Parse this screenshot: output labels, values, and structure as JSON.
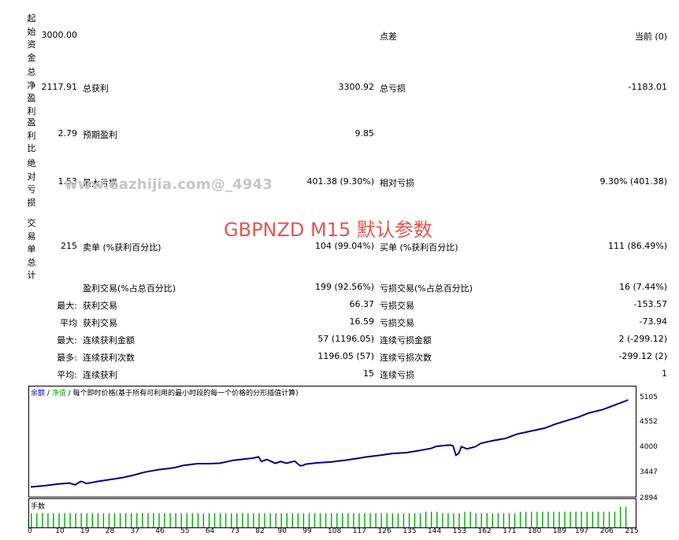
{
  "stats": {
    "rows": [
      {
        "label": "起始资金",
        "value": "3000.00",
        "mid_label": "",
        "mid_value": "",
        "right_label": "点差",
        "right_value": "当前 (0)"
      },
      {
        "label": "总净盈利",
        "value": "2117.91",
        "mid_label": "总获利",
        "mid_value": "3300.92",
        "right_label": "总亏损",
        "right_value": "-1183.01"
      },
      {
        "label": "盈利比",
        "value": "2.79",
        "mid_label": "预期盈利",
        "mid_value": "9.85",
        "right_label": "",
        "right_value": ""
      },
      {
        "label": "绝对亏损",
        "value": "1.53",
        "mid_label": "最大亏损",
        "mid_value": "401.38 (9.30%)",
        "right_label": "相对亏损",
        "right_value": "9.30% (401.38)"
      },
      {
        "label": "交易单总计",
        "value": "215",
        "mid_label": "卖单 (%获利百分比)",
        "mid_value": "104 (99.04%)",
        "right_label": "买单 (%获利百分比)",
        "right_value": "111 (86.49%)"
      }
    ],
    "subrows": [
      {
        "prefix": "",
        "mid_label": "盈利交易(%占总百分比)",
        "mid_value": "199 (92.56%)",
        "right_label": "亏损交易(%占总百分比)",
        "right_value": "16 (7.44%)"
      },
      {
        "prefix": "最大:",
        "mid_label": "获利交易",
        "mid_value": "66.37",
        "right_label": "亏损交易",
        "right_value": "-153.57"
      },
      {
        "prefix": "平均",
        "mid_label": "获利交易",
        "mid_value": "16.59",
        "right_label": "亏损交易",
        "right_value": "-73.94"
      },
      {
        "prefix": "最大:",
        "mid_label": "连续获利金额",
        "mid_value": "57 (1196.05)",
        "right_label": "连续亏损金额",
        "right_value": "2 (-299.12)"
      },
      {
        "prefix": "最多:",
        "mid_label": "连续获利次数",
        "mid_value": "1196.05 (57)",
        "right_label": "连续亏损次数",
        "right_value": "-299.12 (2)"
      },
      {
        "prefix": "平均:",
        "mid_label": "连续获利",
        "mid_value": "15",
        "right_label": "连续亏损",
        "right_value": "1"
      }
    ]
  },
  "watermark": "www.eazhijia.com@_4943",
  "headline": "GBPNZD M15 默认参数",
  "chart_legend": {
    "balance": "余额",
    "sep1": " / ",
    "equity": "净值",
    "sep2": " / ",
    "desc": "每个即时价格(基于所有可利用的最小时段的每一个价格的分形插值计算)"
  },
  "volume_label": "手数",
  "colors": {
    "balance_line": "#000088",
    "volume_bar": "#00aa00",
    "headline": "#e55450"
  },
  "chart_data": {
    "type": "line",
    "title": "",
    "xlabel": "",
    "ylabel": "",
    "x_ticks": [
      "0",
      "10",
      "19",
      "28",
      "37",
      "46",
      "55",
      "64",
      "73",
      "82",
      "90",
      "99",
      "108",
      "117",
      "126",
      "135",
      "144",
      "153",
      "162",
      "171",
      "180",
      "189",
      "197",
      "206",
      "215"
    ],
    "y_ticks": [
      "5105",
      "4552",
      "4000",
      "3447",
      "2894"
    ],
    "ylim": [
      2894,
      5200
    ],
    "xlim": [
      0,
      216
    ],
    "series": [
      {
        "values_x": [
          0,
          5,
          10,
          14,
          16,
          18,
          19,
          20,
          24,
          28,
          33,
          37,
          41,
          46,
          50,
          52,
          55,
          60,
          64,
          68,
          73,
          77,
          80,
          82,
          83,
          85,
          88,
          90,
          92,
          95,
          96,
          97,
          98,
          99,
          103,
          108,
          113,
          117,
          121,
          126,
          130,
          135,
          139,
          144,
          146,
          149,
          151,
          152,
          153,
          154,
          155,
          157,
          160,
          162,
          166,
          171,
          175,
          180,
          185,
          189,
          193,
          197,
          201,
          206,
          210,
          215
        ],
        "values": [
          3050,
          3080,
          3120,
          3140,
          3100,
          3180,
          3165,
          3130,
          3180,
          3220,
          3270,
          3330,
          3400,
          3460,
          3490,
          3510,
          3560,
          3600,
          3600,
          3610,
          3680,
          3710,
          3730,
          3760,
          3650,
          3700,
          3610,
          3650,
          3610,
          3660,
          3600,
          3550,
          3560,
          3590,
          3620,
          3640,
          3680,
          3720,
          3760,
          3800,
          3840,
          3860,
          3900,
          3960,
          4010,
          4030,
          4040,
          4020,
          3800,
          3840,
          4000,
          3950,
          4000,
          4080,
          4140,
          4200,
          4300,
          4370,
          4440,
          4540,
          4620,
          4700,
          4800,
          4880,
          4980,
          5105
        ]
      }
    ],
    "volume": {
      "x_range": [
        0,
        215
      ],
      "mostly_value": "constant",
      "last_segment_higher": true
    },
    "grid": false,
    "legend": "top-left"
  }
}
